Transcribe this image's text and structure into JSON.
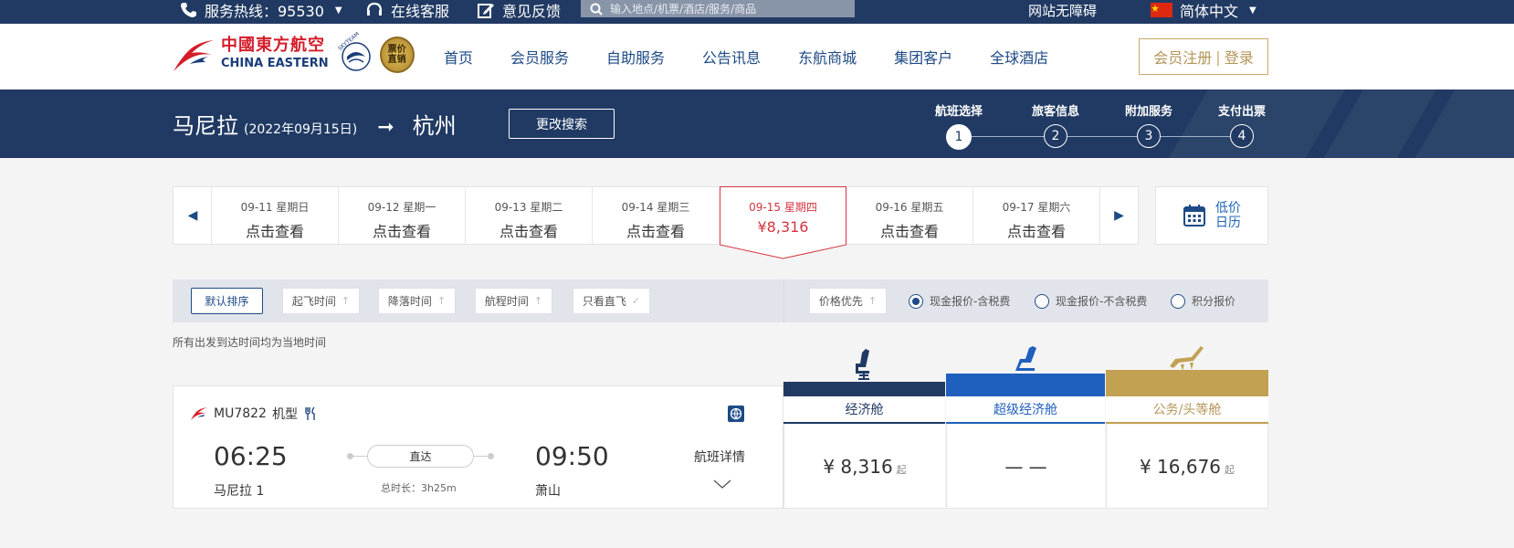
{
  "topbar": {
    "hotline": "服务热线：95530",
    "online_service": "在线客服",
    "feedback": "意见反馈",
    "search_placeholder": "输入地点/机票/酒店/服务/商品",
    "accessibility": "网站无障碍",
    "language": "简体中文"
  },
  "header": {
    "logo_cn": "中國東方航空",
    "logo_en": "CHINA EASTERN",
    "skyteam": "SKYTEAM",
    "badge": "票价直销",
    "nav": [
      "首页",
      "会员服务",
      "自助服务",
      "公告讯息",
      "东航商城",
      "集团客户",
      "全球酒店"
    ],
    "register": "会员注册",
    "login": "登录"
  },
  "route": {
    "from": "马尼拉",
    "date": "(2022年09月15日)",
    "to": "杭州",
    "modify": "更改搜索",
    "steps": [
      {
        "label": "航班选择",
        "num": "1"
      },
      {
        "label": "旅客信息",
        "num": "2"
      },
      {
        "label": "附加服务",
        "num": "3"
      },
      {
        "label": "支付出票",
        "num": "4"
      }
    ]
  },
  "dates": [
    {
      "day": "09-11 星期日",
      "value": "点击查看"
    },
    {
      "day": "09-12 星期一",
      "value": "点击查看"
    },
    {
      "day": "09-13 星期二",
      "value": "点击查看"
    },
    {
      "day": "09-14 星期三",
      "value": "点击查看"
    },
    {
      "day": "09-15 星期四",
      "value": "¥8,316"
    },
    {
      "day": "09-16 星期五",
      "value": "点击查看"
    },
    {
      "day": "09-17 星期六",
      "value": "点击查看"
    }
  ],
  "lowcal": {
    "line1": "低价",
    "line2": "日历"
  },
  "sort": {
    "default": "默认排序",
    "depart": "起飞时间",
    "arrive": "降落时间",
    "duration": "航程时间",
    "direct_only": "只看直飞",
    "price_first": "价格优先",
    "radio1": "现金报价-含税费",
    "radio2": "现金报价-不含税费",
    "radio3": "积分报价"
  },
  "note": "所有出发到达时间均为当地时间",
  "cabins": [
    {
      "name": "经济舱",
      "price": "¥ 8,316",
      "suffix": "起",
      "color": "#213a63"
    },
    {
      "name": "超级经济舱",
      "price": "— —",
      "suffix": "",
      "color": "#1f5fbd"
    },
    {
      "name": "公务/头等舱",
      "price": "¥ 16,676",
      "suffix": "起",
      "color": "#c2a153"
    }
  ],
  "flight": {
    "number": "MU7822",
    "aircraft_label": "机型",
    "dep_time": "06:25",
    "dep_airport": "马尼拉 1",
    "direct": "直达",
    "duration": "总时长：3h25m",
    "arr_time": "09:50",
    "arr_airport": "萧山",
    "detail": "航班详情"
  }
}
